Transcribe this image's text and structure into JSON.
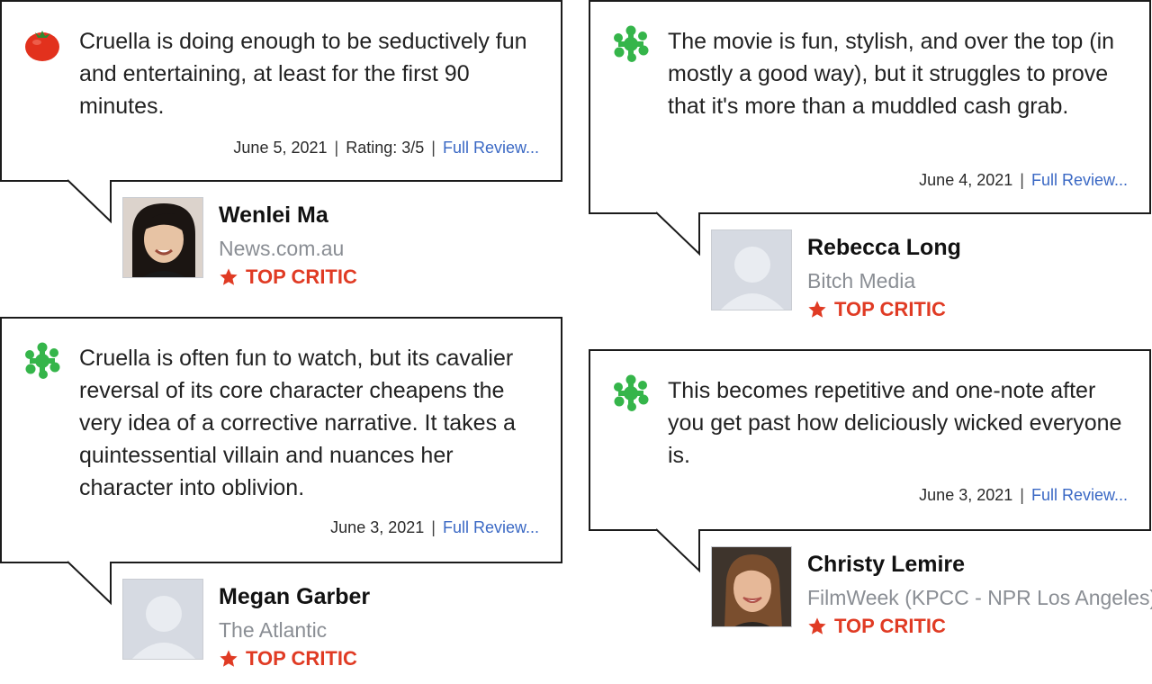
{
  "reviews": [
    {
      "score": "fresh-tomato-icon",
      "quote": "Cruella is doing enough to be seductively fun and entertaining, at least for the first 90 minutes.",
      "date": "June 5, 2021",
      "rating": "Rating: 3/5",
      "link": "Full Review...",
      "name": "Wenlei Ma",
      "publication": "News.com.au",
      "badge": "TOP CRITIC",
      "avatar": "photo-woman-dark-hair"
    },
    {
      "score": "rotten-splat-icon",
      "quote": "The movie is fun, stylish, and over the top (in mostly a good way), but it struggles to prove that it's more than a muddled cash grab.",
      "date": "June 4, 2021",
      "link": "Full Review...",
      "name": "Rebecca Long",
      "publication": "Bitch Media",
      "badge": "TOP CRITIC",
      "avatar": "placeholder-avatar"
    },
    {
      "score": "rotten-splat-icon",
      "quote": "Cruella is often fun to watch, but its cavalier reversal of its core character cheapens the very idea of a corrective narrative. It takes a quintessential villain and nuances her character into oblivion.",
      "date": "June 3, 2021",
      "link": "Full Review...",
      "name": "Megan Garber",
      "publication": "The Atlantic",
      "badge": "TOP CRITIC",
      "avatar": "placeholder-avatar"
    },
    {
      "score": "rotten-splat-icon",
      "quote": "This becomes repetitive and one-note after you get past how deliciously wicked everyone is.",
      "date": "June 3, 2021",
      "link": "Full Review...",
      "name": "Christy Lemire",
      "publication": "FilmWeek (KPCC - NPR Los Angeles)",
      "badge": "TOP CRITIC",
      "avatar": "photo-woman-light-hair"
    }
  ],
  "colors": {
    "link": "#3a68c4",
    "top_critic": "#e03b24",
    "splat": "#35b54a",
    "tomato": "#e2311d"
  }
}
